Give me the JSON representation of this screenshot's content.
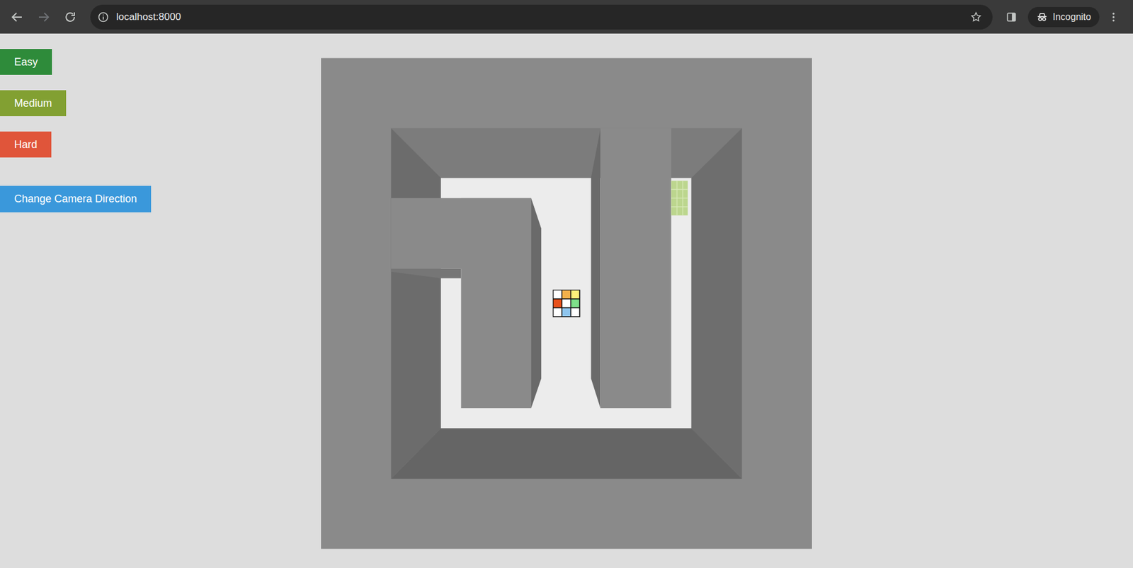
{
  "browser": {
    "url": "localhost:8000",
    "profile": "Incognito",
    "back_disabled": false,
    "forward_disabled": true
  },
  "buttons": [
    {
      "label": "Easy",
      "color": "#2e8b3a"
    },
    {
      "label": "Medium",
      "color": "#82a032"
    },
    {
      "label": "Hard",
      "color": "#e0553a"
    }
  ],
  "camera_button": {
    "label": "Change Camera Direction",
    "color": "#3a98db"
  }
}
